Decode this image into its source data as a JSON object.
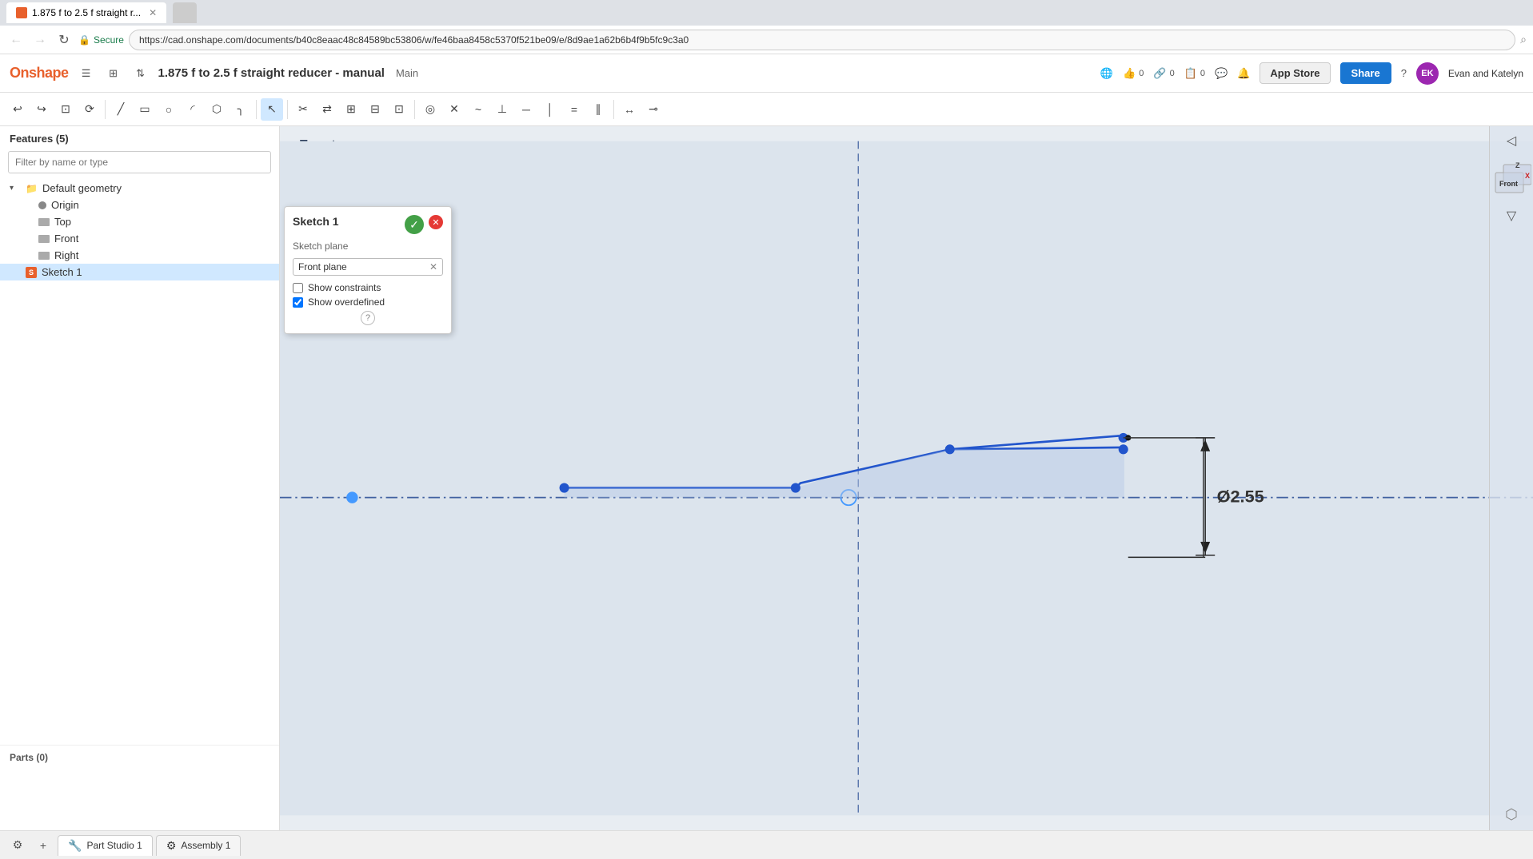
{
  "browser": {
    "tab_title": "1.875 f to 2.5 f straight r...",
    "tab_favicon": "OS",
    "url": "https://cad.onshape.com/documents/b40c8eaac48c84589bc53806/w/fe46baa8458c5370f521be09/e/8d9ae1a62b6b4f9b5fc9c3a0",
    "secure_label": "Secure"
  },
  "header": {
    "logo": "Onshape",
    "doc_title": "1.875 f to 2.5 f straight reducer - manual",
    "branch": "Main",
    "likes": "0",
    "links": "0",
    "copies": "0",
    "app_store": "App Store",
    "share": "Share",
    "user": "Evan and Katelyn",
    "help": "?"
  },
  "features_panel": {
    "title": "Features (5)",
    "filter_placeholder": "Filter by name or type",
    "tree": [
      {
        "type": "group",
        "label": "Default geometry",
        "expanded": true
      },
      {
        "type": "dot",
        "label": "Origin",
        "indent": 1
      },
      {
        "type": "folder",
        "label": "Top",
        "indent": 1
      },
      {
        "type": "folder",
        "label": "Front",
        "indent": 1
      },
      {
        "type": "folder",
        "label": "Right",
        "indent": 1
      },
      {
        "type": "sketch",
        "label": "Sketch 1",
        "indent": 0,
        "selected": true
      }
    ],
    "parts_title": "Parts (0)"
  },
  "sketch_panel": {
    "title": "Sketch 1",
    "sketch_plane_label": "Sketch plane",
    "sketch_plane_value": "Front plane",
    "show_constraints_label": "Show constraints",
    "show_constraints_checked": false,
    "show_overdefined_label": "Show overdefined",
    "show_overdefined_checked": true,
    "ok_symbol": "✓",
    "close_symbol": "✕",
    "help_symbol": "?"
  },
  "viewport": {
    "label": "Front",
    "dimension_label": "Ø2.55"
  },
  "bottom_bar": {
    "part_studio_label": "Part Studio 1",
    "assembly_label": "Assembly 1"
  },
  "toolbar": {
    "undo": "↩",
    "redo": "↪",
    "copy": "⊡",
    "transform": "⟳",
    "line_tool": "/",
    "rect": "▭",
    "circle": "○",
    "arc": "⌒",
    "polygon": "⬡",
    "fillet": ")",
    "sketch_select": "↖",
    "trim": "✂",
    "mirror": "⇄",
    "linear_pat": "⊞",
    "grid": "⊞",
    "measure": "📐",
    "select": "↖",
    "pierce": "✕",
    "center": "⊙",
    "line": "─",
    "tangent": "~",
    "midpoint": "┬",
    "perpendicular": "⊥",
    "equal": "=",
    "coincident": "→",
    "parallel": "∥",
    "dimension": "↔"
  }
}
